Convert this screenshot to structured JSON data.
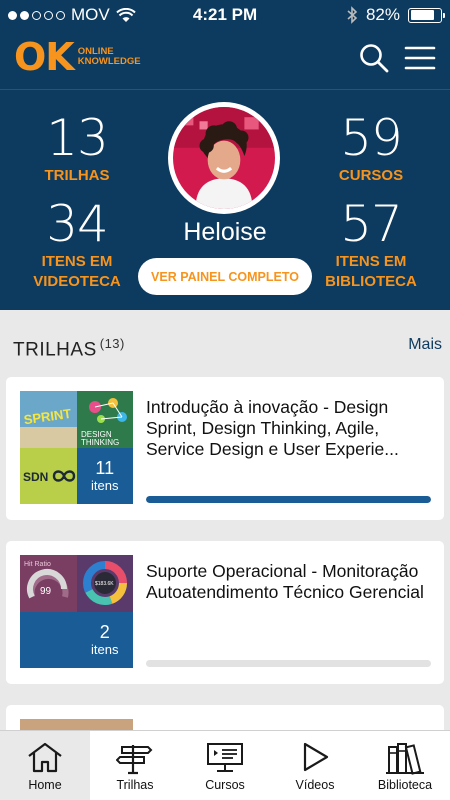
{
  "status_bar": {
    "carrier": "MOV",
    "time": "4:21 PM",
    "battery": "82%",
    "battery_level": 0.82
  },
  "header": {
    "logo_main": "OK",
    "logo_line1": "ONLINE",
    "logo_line2": "KNOWLEDGE",
    "search_icon": "search-icon",
    "menu_icon": "hamburger-menu-icon"
  },
  "profile": {
    "name": "Heloise",
    "button_label": "VER PAINEL COMPLETO",
    "stats": {
      "trilhas": {
        "value": "13",
        "label": "TRILHAS"
      },
      "cursos": {
        "value": "59",
        "label": "CURSOS"
      },
      "videoteca": {
        "value": "34",
        "label_1": "ITENS EM",
        "label_2": "VIDEOTECA"
      },
      "biblioteca": {
        "value": "57",
        "label_1": "ITENS EM",
        "label_2": "BIBLIOTECA"
      }
    }
  },
  "section": {
    "title": "TRILHAS",
    "count": "(13)",
    "more": "Mais"
  },
  "cards": [
    {
      "title": "Introdução à inovação - Design Sprint, Design Thinking, Agile, Service Design e User Experie...",
      "count": "11",
      "count_label": "itens",
      "progress": 1.0,
      "tile_sprint": "SPRINT",
      "tile_design_1": "DESIGN",
      "tile_design_2": "THINKING",
      "tile_sdn": "SDN"
    },
    {
      "title": "Suporte Operacional - Monitoração Autoatendimento Técnico Gerencial",
      "count": "2",
      "count_label": "itens",
      "progress": 0.0,
      "gauge_label": "Hit Ratio",
      "gauge_value": "99",
      "donut_value": "$183.6K"
    }
  ],
  "tabs": [
    {
      "label": "Home",
      "icon": "home-icon",
      "active": true
    },
    {
      "label": "Trilhas",
      "icon": "signpost-icon",
      "active": false
    },
    {
      "label": "Cursos",
      "icon": "presentation-board-icon",
      "active": false
    },
    {
      "label": "Vídeos",
      "icon": "play-icon",
      "active": false
    },
    {
      "label": "Biblioteca",
      "icon": "books-icon",
      "active": false
    }
  ],
  "colors": {
    "navy": "#0d3a5f",
    "orange": "#f7941d",
    "accent_blue": "#1a5c96",
    "background": "#e9e9e9"
  }
}
